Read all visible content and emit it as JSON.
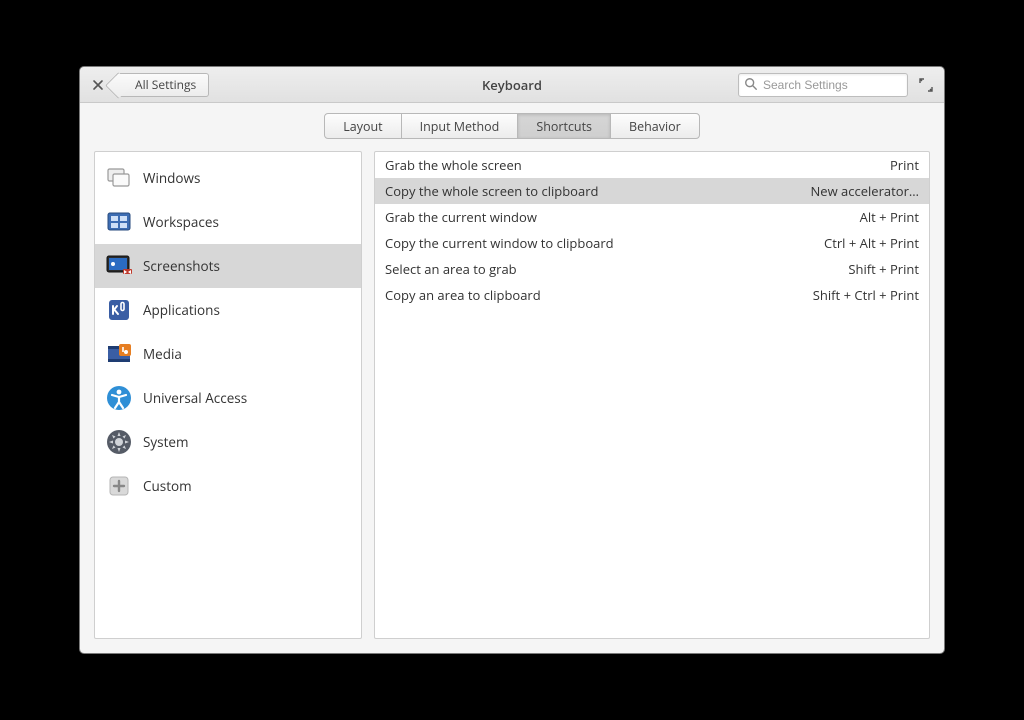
{
  "header": {
    "title": "Keyboard",
    "back_label": "All Settings",
    "search_placeholder": "Search Settings"
  },
  "tabs": [
    {
      "id": "layout",
      "label": "Layout",
      "active": false
    },
    {
      "id": "input-method",
      "label": "Input Method",
      "active": false
    },
    {
      "id": "shortcuts",
      "label": "Shortcuts",
      "active": true
    },
    {
      "id": "behavior",
      "label": "Behavior",
      "active": false
    }
  ],
  "categories": [
    {
      "id": "windows",
      "label": "Windows",
      "icon": "windows",
      "selected": false
    },
    {
      "id": "workspaces",
      "label": "Workspaces",
      "icon": "workspaces",
      "selected": false
    },
    {
      "id": "screenshots",
      "label": "Screenshots",
      "icon": "screenshots",
      "selected": true
    },
    {
      "id": "applications",
      "label": "Applications",
      "icon": "applications",
      "selected": false
    },
    {
      "id": "media",
      "label": "Media",
      "icon": "media",
      "selected": false
    },
    {
      "id": "universal-access",
      "label": "Universal Access",
      "icon": "universal-access",
      "selected": false
    },
    {
      "id": "system",
      "label": "System",
      "icon": "system",
      "selected": false
    },
    {
      "id": "custom",
      "label": "Custom",
      "icon": "custom",
      "selected": false
    }
  ],
  "shortcuts": [
    {
      "label": "Grab the whole screen",
      "accel": "Print",
      "selected": false
    },
    {
      "label": "Copy the whole screen to clipboard",
      "accel": "New accelerator…",
      "selected": true
    },
    {
      "label": "Grab the current window",
      "accel": "Alt + Print",
      "selected": false
    },
    {
      "label": "Copy the current window to clipboard",
      "accel": "Ctrl + Alt + Print",
      "selected": false
    },
    {
      "label": "Select an area to grab",
      "accel": "Shift + Print",
      "selected": false
    },
    {
      "label": "Copy an area to clipboard",
      "accel": "Shift + Ctrl + Print",
      "selected": false
    }
  ]
}
